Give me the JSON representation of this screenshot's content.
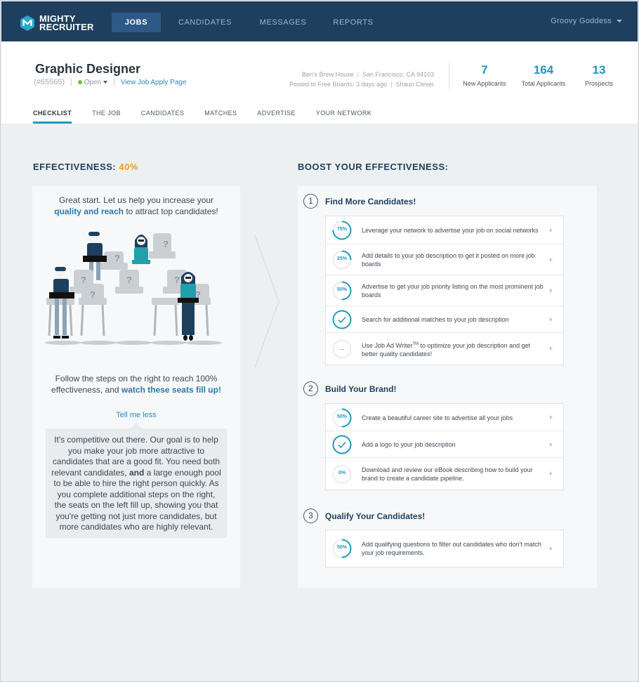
{
  "app": {
    "logo_line1": "MIGHTY",
    "logo_line2": "RECRUITER"
  },
  "nav": {
    "items": [
      {
        "label": "JOBS",
        "active": true
      },
      {
        "label": "CANDIDATES"
      },
      {
        "label": "MESSAGES"
      },
      {
        "label": "REPORTS"
      }
    ],
    "user": "Groovy Goddess"
  },
  "job": {
    "title": "Graphic Designer",
    "id": "(#65565)",
    "status": "Open",
    "apply_link": "View Job Apply Page",
    "company": "Ben's Brew House",
    "location": "San Francisco, CA 94103",
    "posted": "Posted to Free Boards: 3 days ago",
    "owner": "Shaun Clever"
  },
  "stats": [
    {
      "value": "7",
      "label": "New Applicants"
    },
    {
      "value": "164",
      "label": "Total Applicants"
    },
    {
      "value": "13",
      "label": "Prospects"
    }
  ],
  "tabs": [
    "CHECKLIST",
    "THE JOB",
    "CANDIDATES",
    "MATCHES",
    "ADVERTISE",
    "YOUR NETWORK"
  ],
  "effectiveness": {
    "label": "EFFECTIVENESS:",
    "value": "40%",
    "intro_a": "Great start. Let us help you increase your",
    "intro_hl": "quality and reach",
    "intro_b": "to attract top candidates!",
    "follow_a": "Follow the steps on the right to reach 100% effectiveness, and",
    "follow_hl": "watch these seats fill up!",
    "tell_less": "Tell me less",
    "explain_a": "It's competitive out there. Our goal is to help you make your job more attractive to candidates that are a good fit. You need both relevant candidates,",
    "explain_bold": "and",
    "explain_b": "a large enough pool to be able to hire the right person quickly. As you complete additional steps on the right, the seats on the left fill up, showing you that you're getting not just more candidates, but more candidates who are highly relevant.",
    "seat_mark": "?"
  },
  "boost": {
    "heading": "BOOST YOUR EFFECTIVENESS:",
    "steps": [
      {
        "num": "1",
        "title": "Find More Candidates!",
        "tasks": [
          {
            "progress": 0.75,
            "label": "75%",
            "text": "Leverage your network to advertise your job on social networks"
          },
          {
            "progress": 0.25,
            "label": "25%",
            "text": "Add details to your job description to get it posted on more job boards"
          },
          {
            "progress": 0.5,
            "label": "50%",
            "text": "Advertise to get your job priority listing on the most prominent job boards"
          },
          {
            "progress": 1,
            "label": "",
            "done": true,
            "text": "Search for additional matches to your job description"
          },
          {
            "progress": 0,
            "label": "–",
            "text_a": "Use Job Ad Writer",
            "text_sup": "TM",
            "text_b": " to optimize your job description and get better quality candidates!"
          }
        ]
      },
      {
        "num": "2",
        "title": "Build Your Brand!",
        "tasks": [
          {
            "progress": 0.5,
            "label": "50%",
            "text": "Create a beautiful career site to advertise all your jobs"
          },
          {
            "progress": 1,
            "label": "",
            "done": true,
            "text": "Add a logo to your job description"
          },
          {
            "progress": 0,
            "label": "0%",
            "text": "Download and review our eBook describing how to build your brand to create a candidate pipeline."
          }
        ]
      },
      {
        "num": "3",
        "title": "Qualify Your Candidates!",
        "tasks": [
          {
            "progress": 0.5,
            "label": "50%",
            "text": "Add qualifying questions to filter out candidates who don't match your job requirements."
          }
        ]
      }
    ]
  },
  "colors": {
    "navy": "#1f3f5e",
    "accent": "#1f98bf",
    "orange": "#f39a1f",
    "green": "#6cbe45"
  }
}
